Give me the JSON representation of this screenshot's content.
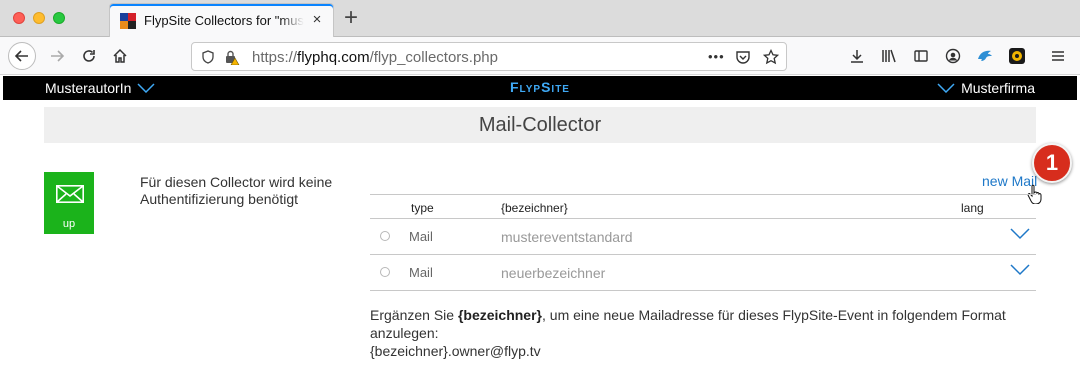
{
  "browser": {
    "tab_title": "FlypSite Collectors for \"musterf",
    "tab_close": "×",
    "new_tab": "+",
    "url_scheme": "https://",
    "url_host": "flyphq.com",
    "url_path": "/flyp_collectors.php",
    "url_more": "•••"
  },
  "appbar": {
    "user": "MusterautorIn",
    "logo": "FlypSite",
    "company": "Musterfirma",
    "logo_color": "#3fa9f5"
  },
  "page": {
    "title": "Mail-Collector",
    "collector_label": "up",
    "collector_color": "#1bb31b",
    "auth_note": "Für diesen Collector wird keine Authentifizierung benötigt",
    "badge": "1",
    "new_mail": "new Mail",
    "table": {
      "headers": {
        "type": "type",
        "bezeichner": "{bezeichner}",
        "lang": "lang"
      },
      "rows": [
        {
          "type": "Mail",
          "bezeichner": "mustereventstandard"
        },
        {
          "type": "Mail",
          "bezeichner": "neuerbezeichner"
        }
      ]
    },
    "hint_prefix": "Ergänzen Sie ",
    "hint_bold": "{bezeichner}",
    "hint_suffix": ", um eine neue Mailadresse für dieses FlypSite-Event in folgendem Format anzulegen:",
    "hint_line2": "{bezeichner}.owner@flyp.tv"
  }
}
